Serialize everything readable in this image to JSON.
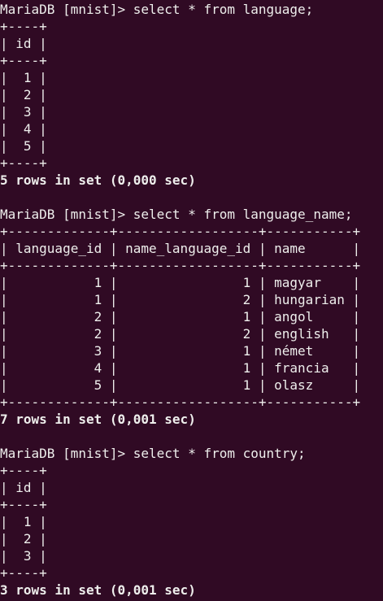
{
  "terminal": {
    "lines": [
      {
        "text": "MariaDB [mnist]> select * from language;",
        "kind": "prompt"
      },
      {
        "text": "+----+",
        "kind": "border"
      },
      {
        "text": "| id |",
        "kind": "header"
      },
      {
        "text": "+----+",
        "kind": "border"
      },
      {
        "text": "|  1 |",
        "kind": "row"
      },
      {
        "text": "|  2 |",
        "kind": "row"
      },
      {
        "text": "|  3 |",
        "kind": "row"
      },
      {
        "text": "|  4 |",
        "kind": "row"
      },
      {
        "text": "|  5 |",
        "kind": "row"
      },
      {
        "text": "+----+",
        "kind": "border"
      },
      {
        "text": "5 rows in set (0,000 sec)",
        "kind": "result"
      },
      {
        "text": "",
        "kind": "blank"
      },
      {
        "text": "MariaDB [mnist]> select * from language_name;",
        "kind": "prompt"
      },
      {
        "text": "+-------------+------------------+-----------+",
        "kind": "border"
      },
      {
        "text": "| language_id | name_language_id | name      |",
        "kind": "header"
      },
      {
        "text": "+-------------+------------------+-----------+",
        "kind": "border"
      },
      {
        "text": "|           1 |                1 | magyar    |",
        "kind": "row"
      },
      {
        "text": "|           1 |                2 | hungarian |",
        "kind": "row"
      },
      {
        "text": "|           2 |                1 | angol     |",
        "kind": "row"
      },
      {
        "text": "|           2 |                2 | english   |",
        "kind": "row"
      },
      {
        "text": "|           3 |                1 | német     |",
        "kind": "row"
      },
      {
        "text": "|           4 |                1 | francia   |",
        "kind": "row"
      },
      {
        "text": "|           5 |                1 | olasz     |",
        "kind": "row"
      },
      {
        "text": "+-------------+------------------+-----------+",
        "kind": "border"
      },
      {
        "text": "7 rows in set (0,001 sec)",
        "kind": "result"
      },
      {
        "text": "",
        "kind": "blank"
      },
      {
        "text": "MariaDB [mnist]> select * from country;",
        "kind": "prompt"
      },
      {
        "text": "+----+",
        "kind": "border"
      },
      {
        "text": "| id |",
        "kind": "header"
      },
      {
        "text": "+----+",
        "kind": "border"
      },
      {
        "text": "|  1 |",
        "kind": "row"
      },
      {
        "text": "|  2 |",
        "kind": "row"
      },
      {
        "text": "|  3 |",
        "kind": "row"
      },
      {
        "text": "+----+",
        "kind": "border"
      },
      {
        "text": "3 rows in set (0,001 sec)",
        "kind": "result"
      }
    ]
  },
  "colors": {
    "background": "#300a24",
    "foreground": "#eeeeec"
  }
}
